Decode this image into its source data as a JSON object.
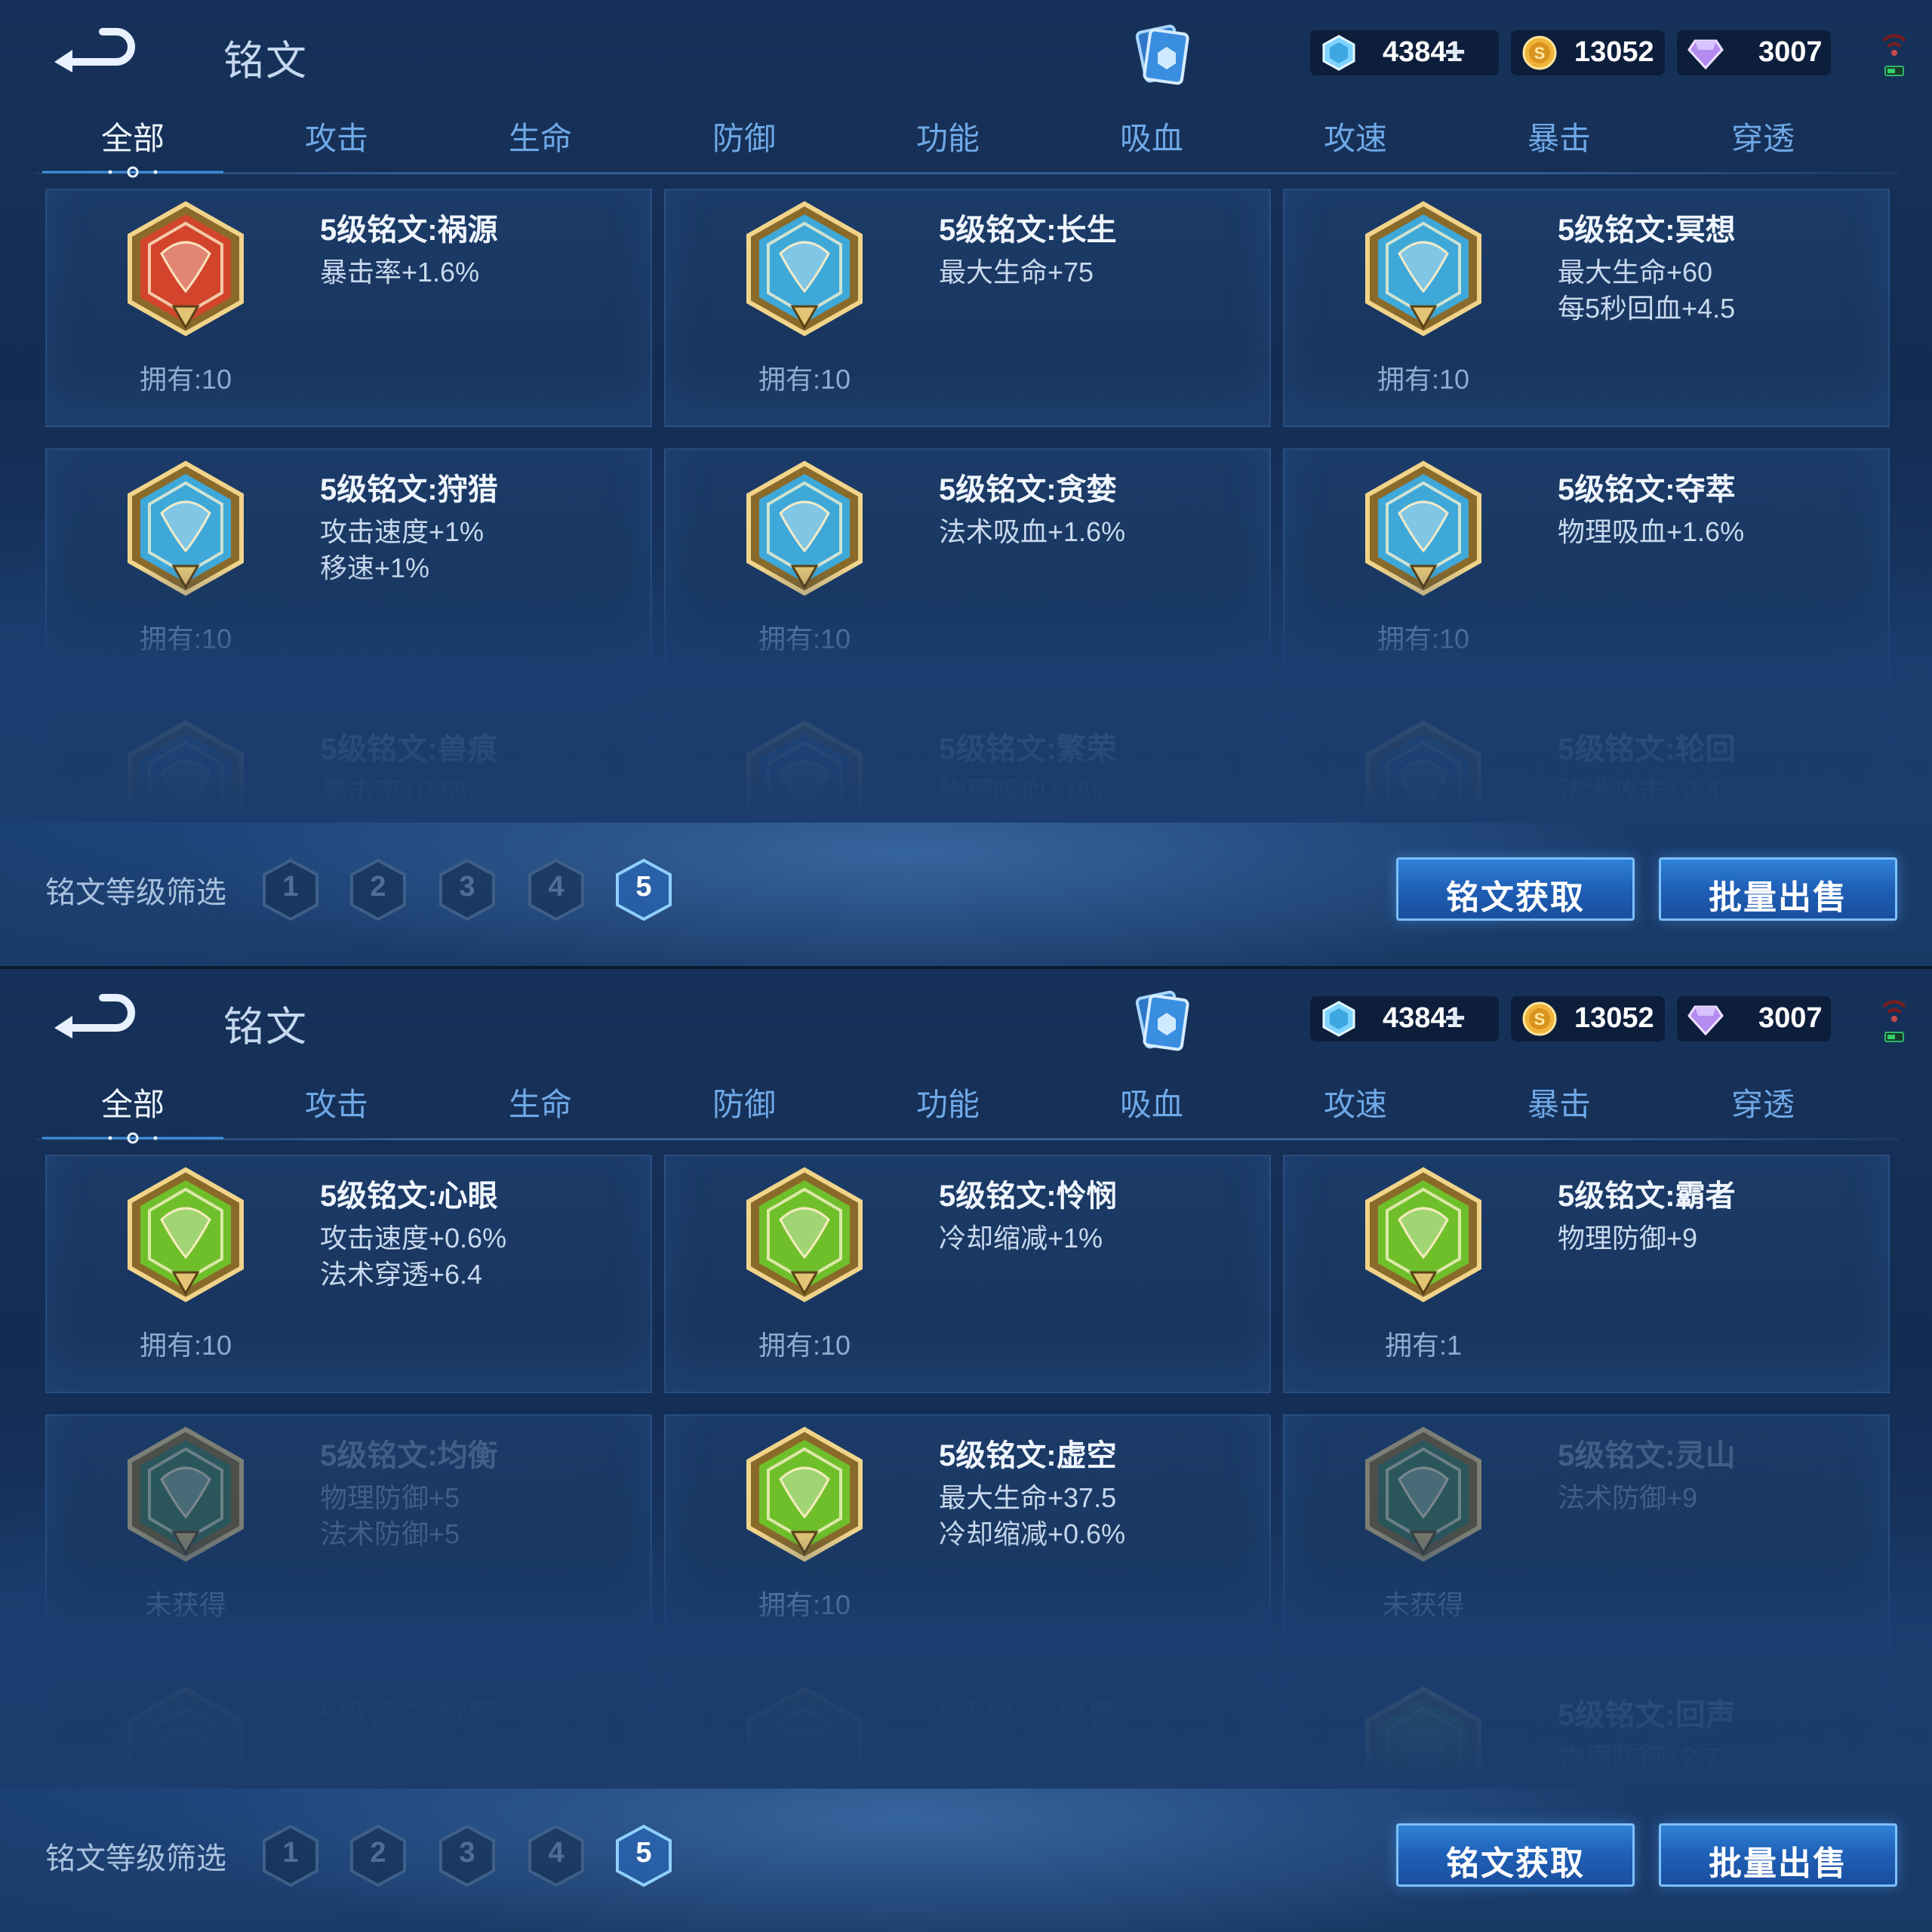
{
  "screens": [
    {
      "title": "铭文",
      "currency": {
        "crystal": "43841",
        "gold": "13052",
        "diamond": "3007"
      },
      "tabs": [
        "全部",
        "攻击",
        "生命",
        "防御",
        "功能",
        "吸血",
        "攻速",
        "暴击",
        "穿透"
      ],
      "active_tab": "全部",
      "cards": [
        {
          "name": "5级铭文:祸源",
          "attrs": [
            "暴击率+1.6%"
          ],
          "owned": "拥有:10",
          "color": "#d2452c",
          "state": "owned"
        },
        {
          "name": "5级铭文:长生",
          "attrs": [
            "最大生命+75"
          ],
          "owned": "拥有:10",
          "color": "#3ea8d8",
          "state": "owned"
        },
        {
          "name": "5级铭文:冥想",
          "attrs": [
            "最大生命+60",
            "每5秒回血+4.5"
          ],
          "owned": "拥有:10",
          "color": "#3ea8d8",
          "state": "owned"
        },
        {
          "name": "5级铭文:狩猎",
          "attrs": [
            "攻击速度+1%",
            "移速+1%"
          ],
          "owned": "拥有:10",
          "color": "#3ea8d8",
          "state": "owned"
        },
        {
          "name": "5级铭文:贪婪",
          "attrs": [
            "法术吸血+1.6%"
          ],
          "owned": "拥有:10",
          "color": "#3ea8d8",
          "state": "owned"
        },
        {
          "name": "5级铭文:夺萃",
          "attrs": [
            "物理吸血+1.6%"
          ],
          "owned": "拥有:10",
          "color": "#3ea8d8",
          "state": "owned"
        },
        {
          "name": "5级铭文:兽痕",
          "attrs": [
            "暴击率+0.5%"
          ],
          "owned": "",
          "color": "#3a7fb8",
          "state": "owned"
        },
        {
          "name": "5级铭文:繁荣",
          "attrs": [
            "物理吸血+1%"
          ],
          "owned": "",
          "color": "#3a7fb8",
          "state": "owned"
        },
        {
          "name": "5级铭文:轮回",
          "attrs": [
            "法术攻击+2.4"
          ],
          "owned": "",
          "color": "#3a7fb8",
          "state": "owned"
        }
      ],
      "filter_label": "铭文等级筛选",
      "levels": [
        "1",
        "2",
        "3",
        "4",
        "5"
      ],
      "active_level": "5",
      "buttons": {
        "acquire": "铭文获取",
        "sell": "批量出售"
      }
    },
    {
      "title": "铭文",
      "currency": {
        "crystal": "43841",
        "gold": "13052",
        "diamond": "3007"
      },
      "tabs": [
        "全部",
        "攻击",
        "生命",
        "防御",
        "功能",
        "吸血",
        "攻速",
        "暴击",
        "穿透"
      ],
      "active_tab": "全部",
      "cards": [
        {
          "name": "5级铭文:心眼",
          "attrs": [
            "攻击速度+0.6%",
            "法术穿透+6.4"
          ],
          "owned": "拥有:10",
          "color": "#6fbf2a",
          "state": "owned"
        },
        {
          "name": "5级铭文:怜悯",
          "attrs": [
            "冷却缩减+1%"
          ],
          "owned": "拥有:10",
          "color": "#6fbf2a",
          "state": "owned"
        },
        {
          "name": "5级铭文:霸者",
          "attrs": [
            "物理防御+9"
          ],
          "owned": "拥有:1",
          "color": "#6fbf2a",
          "state": "owned"
        },
        {
          "name": "5级铭文:均衡",
          "attrs": [
            "物理防御+5",
            "法术防御+5"
          ],
          "owned": "未获得",
          "color": "#3f7a52",
          "state": "missing"
        },
        {
          "name": "5级铭文:虚空",
          "attrs": [
            "最大生命+37.5",
            "冷却缩减+0.6%"
          ],
          "owned": "拥有:10",
          "color": "#6fbf2a",
          "state": "owned"
        },
        {
          "name": "5级铭文:灵山",
          "attrs": [
            "法术防御+9"
          ],
          "owned": "未获得",
          "color": "#3f7a52",
          "state": "missing"
        },
        {
          "name": "5级铭文:献祭",
          "attrs": [
            "法术攻击+2.4"
          ],
          "owned": "",
          "color": "#3f7a52",
          "state": "missing"
        },
        {
          "name": "5级铭文:敬畏",
          "attrs": [
            "法术吸血+0.7%"
          ],
          "owned": "",
          "color": "#3f7a52",
          "state": "missing"
        },
        {
          "name": "5级铭文:回声",
          "attrs": [
            "物理防御+2.7"
          ],
          "owned": "",
          "color": "#6fbf2a",
          "state": "owned"
        }
      ],
      "filter_label": "铭文等级筛选",
      "levels": [
        "1",
        "2",
        "3",
        "4",
        "5"
      ],
      "active_level": "5",
      "buttons": {
        "acquire": "铭文获取",
        "sell": "批量出售"
      }
    }
  ]
}
